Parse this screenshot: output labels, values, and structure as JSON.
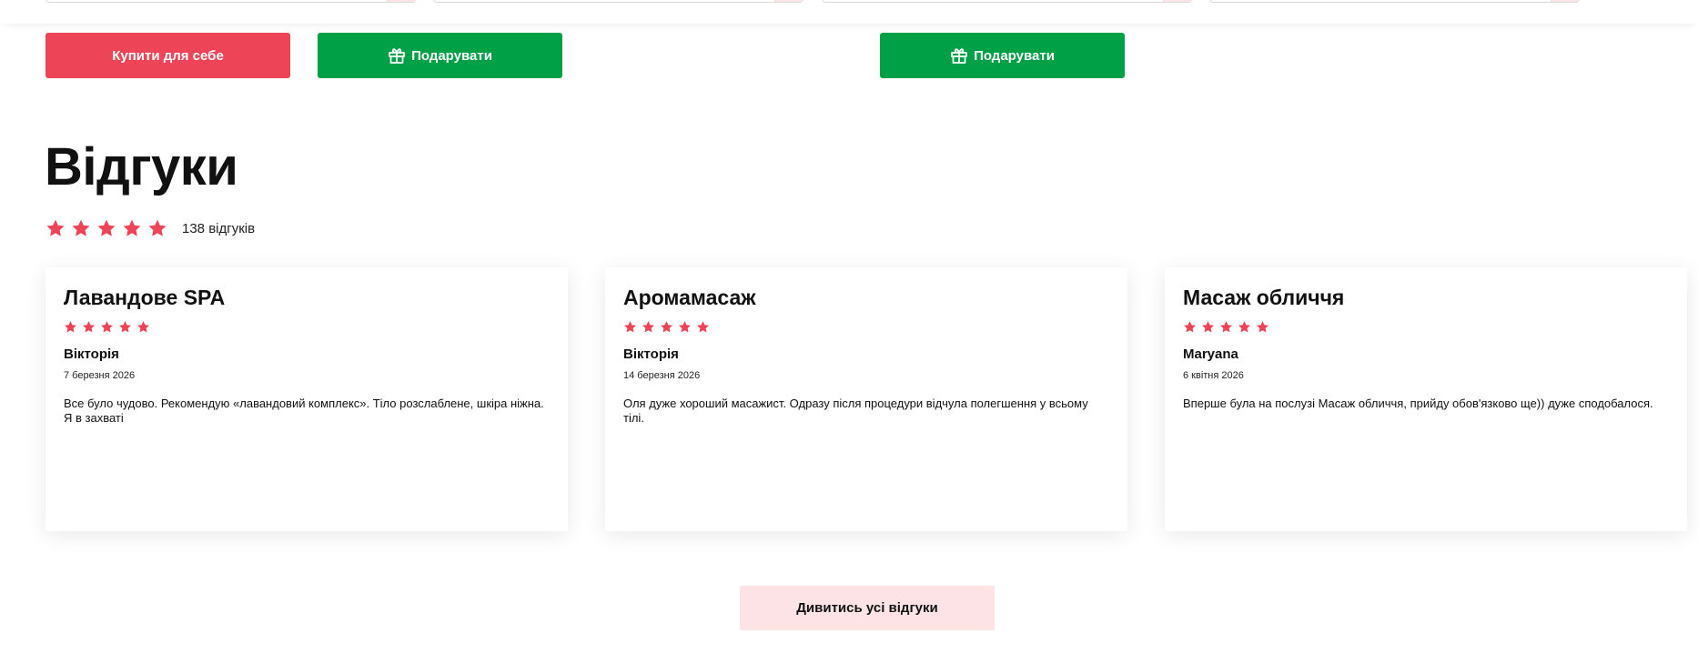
{
  "buttons": {
    "buy_for_self": "Купити для себе",
    "gift": "Подарувати",
    "view_all_reviews": "Дивитись усі відгуки"
  },
  "reviews": {
    "title": "Відгуки",
    "rating_stars": 5,
    "count_label": "138 відгуків",
    "items": [
      {
        "title": "Лавандове SPA",
        "stars": 5,
        "author": "Вікторія",
        "date": "7 березня 2026",
        "text": "Все було чудово. Рекомендую «лавандовий комплекс». Тіло розслаблене, шкіра ніжна. Я в захваті"
      },
      {
        "title": "Аромамасаж",
        "stars": 5,
        "author": "Вікторія",
        "date": "14 березня 2026",
        "text": "Оля дуже хороший масажист. Одразу після процедури відчула полегшення у всьому тілі."
      },
      {
        "title": "Масаж обличчя",
        "stars": 5,
        "author": "Maryana",
        "date": "6 квітня 2026",
        "text": "Вперше була на послузі Масаж обличчя, прийду обов'язково ще)) дуже сподобалося."
      }
    ]
  },
  "icons": {
    "gift": "gift-icon",
    "star": "star-icon"
  },
  "colors": {
    "accent_red": "#ee4458",
    "gift_green": "#00a046",
    "light_pink": "#fde3e5",
    "star_red": "#ee4458"
  }
}
